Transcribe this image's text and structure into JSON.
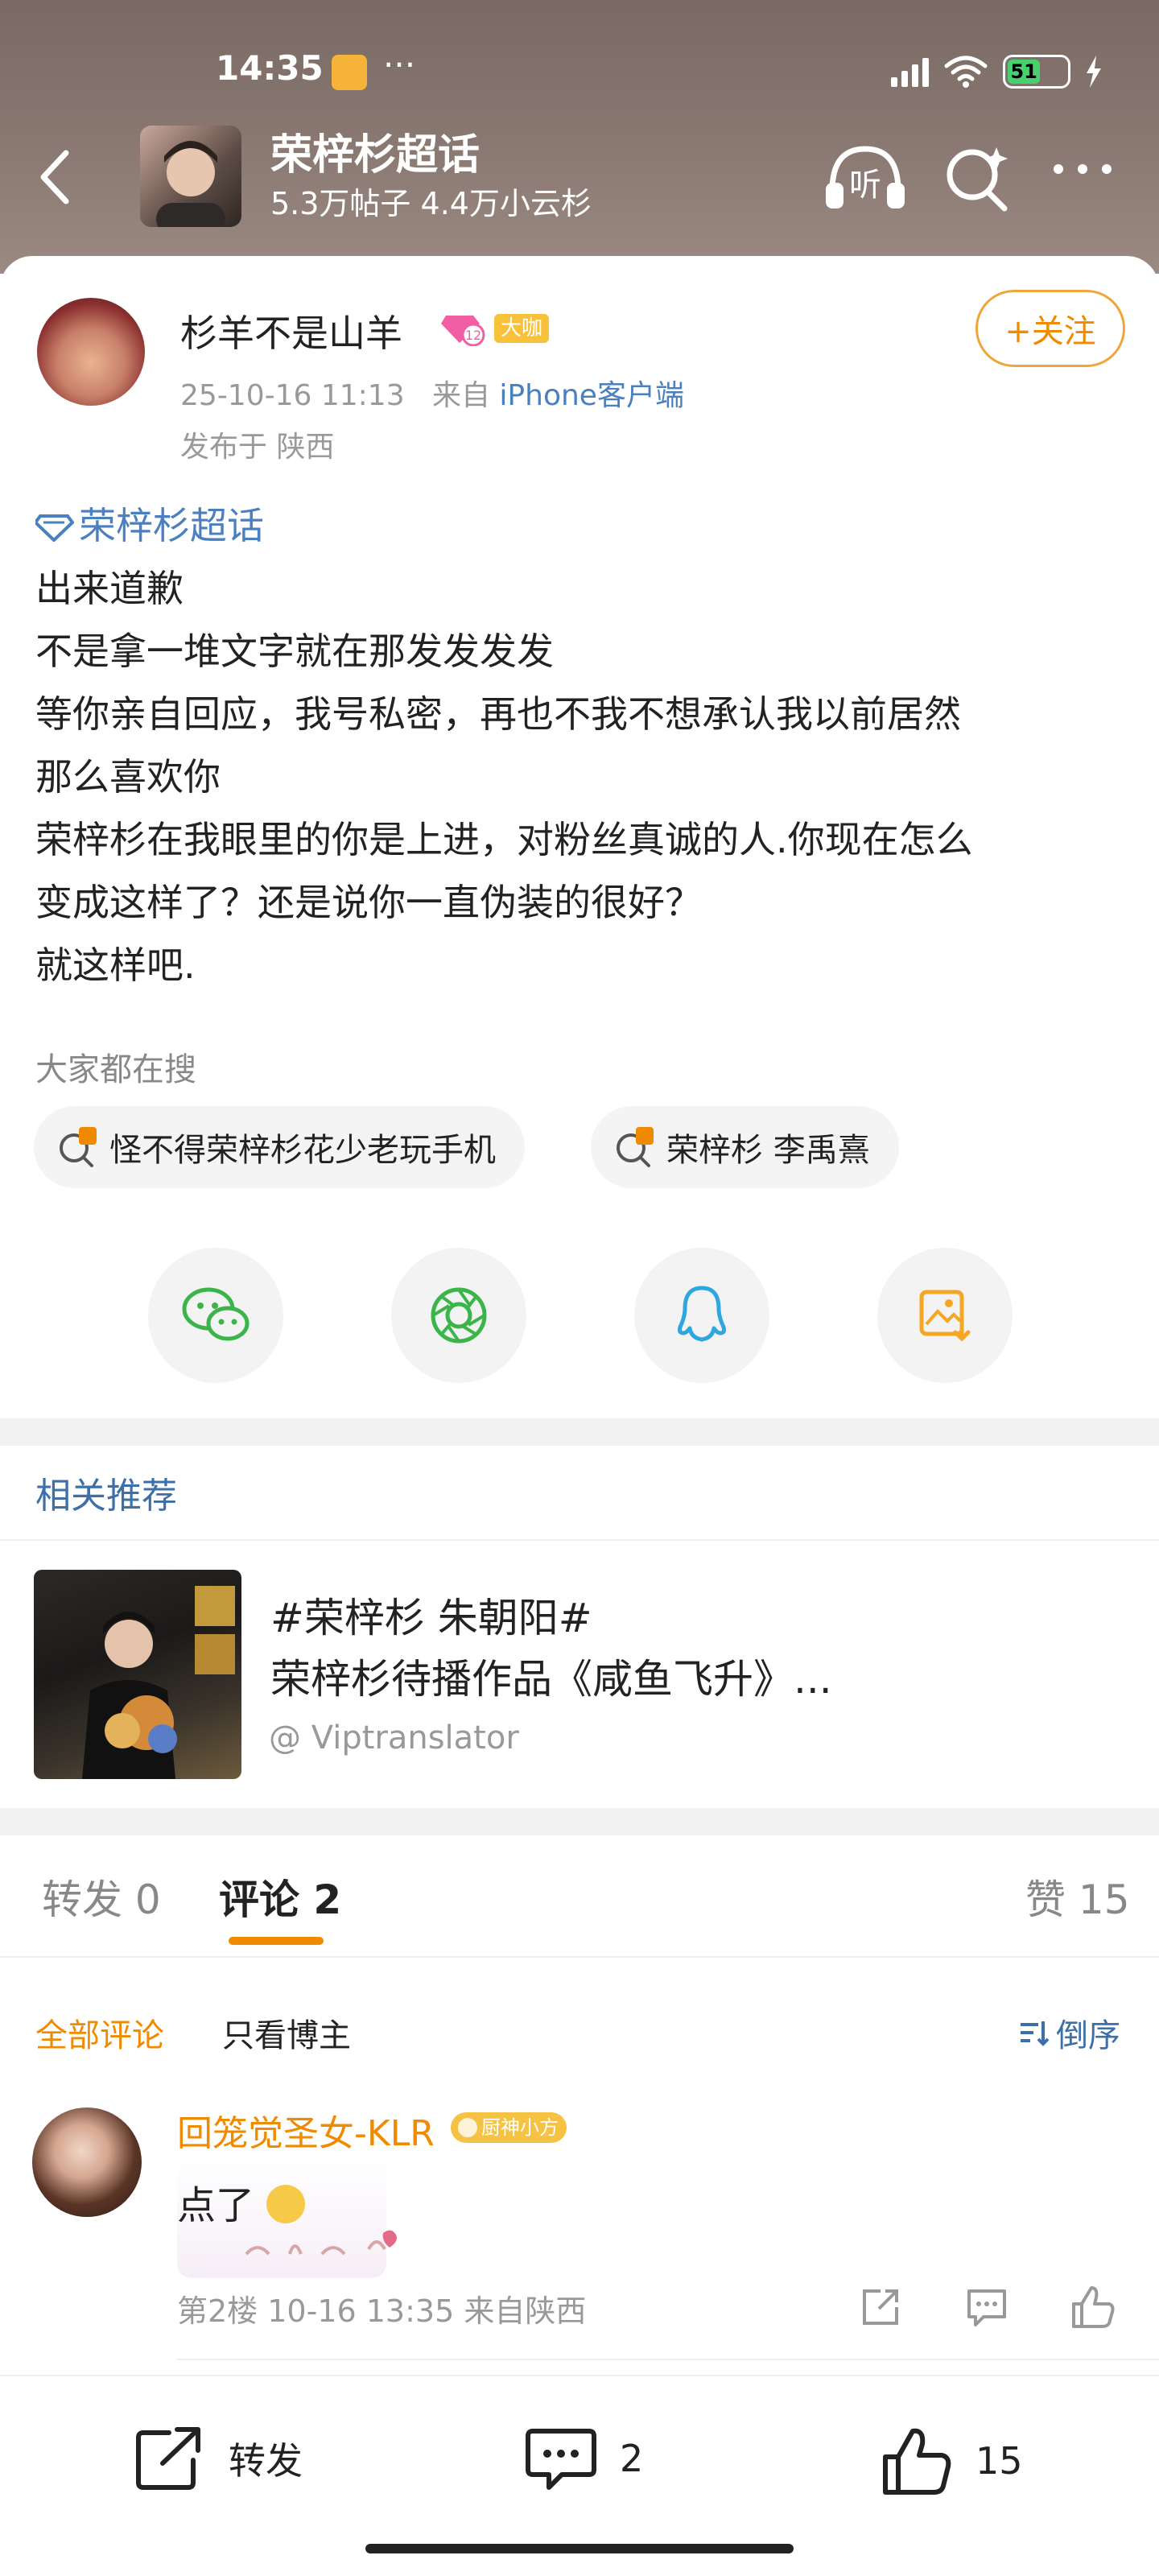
{
  "status_bar": {
    "time": "14:35",
    "dots": "···",
    "battery": "51"
  },
  "header": {
    "title": "荣梓杉超话",
    "subtitle": "5.3万帖子 4.4万小云杉",
    "listen_label": "听"
  },
  "post": {
    "author": "杉羊不是山羊",
    "badge_level": "12",
    "badge_big": "大咖",
    "follow_label": "+关注",
    "time": "25-10-16 11:13",
    "from_prefix": "来自",
    "source": "iPhone客户端",
    "location": "发布于 陕西",
    "topic_tag": "荣梓杉超话",
    "lines": [
      "出来道歉",
      "不是拿一堆文字就在那发发发发",
      "等你亲自回应，我号私密，再也不我不想承认我以前居然",
      "那么喜欢你",
      "荣梓杉在我眼里的你是上进，对粉丝真诚的人.你现在怎么",
      "变成这样了？还是说你一直伪装的很好？",
      "就这样吧."
    ]
  },
  "search": {
    "label": "大家都在搜",
    "chips": [
      "怪不得荣梓杉花少老玩手机",
      "荣梓杉 李禹熹"
    ]
  },
  "share": {
    "icons": [
      "wechat-icon",
      "moments-icon",
      "qq-icon",
      "save-image-icon"
    ]
  },
  "related": {
    "title": "相关推荐",
    "line1": "#荣梓杉 朱朝阳#",
    "line2": "荣梓杉待播作品《咸鱼飞升》...",
    "source": "@ Viptranslator"
  },
  "tabs": {
    "repost": "转发 0",
    "comments": "评论 2",
    "likes": "赞 15"
  },
  "filters": {
    "all": "全部评论",
    "op_only": "只看博主",
    "sort": "倒序"
  },
  "comments": [
    {
      "name": "回笼觉圣女-KLR",
      "badge": "厨神小方",
      "text": "点了",
      "meta": "第2楼 10-16 13:35 来自陕西"
    }
  ],
  "bottom_bar": {
    "repost": "转发",
    "comments": "2",
    "likes": "15"
  },
  "colors": {
    "accent": "#f08a00",
    "link": "#4a7fc0",
    "header_bg": "#86766f"
  }
}
